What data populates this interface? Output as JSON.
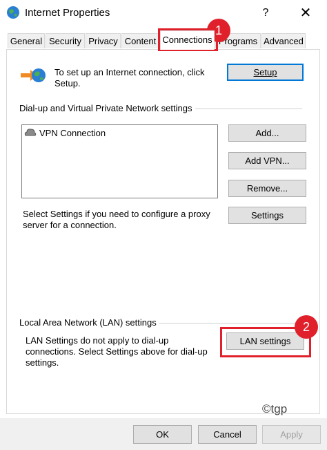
{
  "window": {
    "title": "Internet Properties",
    "help_glyph": "?",
    "close_glyph": "✕"
  },
  "tabs": [
    {
      "label": "General"
    },
    {
      "label": "Security"
    },
    {
      "label": "Privacy"
    },
    {
      "label": "Content"
    },
    {
      "label": "Connections"
    },
    {
      "label": "Programs"
    },
    {
      "label": "Advanced"
    }
  ],
  "setup": {
    "text": "To set up an Internet connection, click Setup.",
    "button": "Setup"
  },
  "dialup": {
    "group_label": "Dial-up and Virtual Private Network settings",
    "list_items": [
      {
        "label": "VPN Connection"
      }
    ],
    "add_button": "Add...",
    "add_vpn_button": "Add VPN...",
    "remove_button": "Remove...",
    "proxy_text": "Select Settings if you need to configure a proxy server for a connection.",
    "settings_button": "Settings"
  },
  "lan": {
    "group_label": "Local Area Network (LAN) settings",
    "text": "LAN Settings do not apply to dial-up connections. Select Settings above for dial-up settings.",
    "button": "LAN settings"
  },
  "annotations": {
    "badge_1": "1",
    "badge_2": "2",
    "highlight_color": "#e0202a"
  },
  "watermark": "©tgp",
  "footer": {
    "ok": "OK",
    "cancel": "Cancel",
    "apply": "Apply"
  },
  "colors": {
    "accent": "#0078d7",
    "button_bg": "#e1e1e1",
    "dialog_bg": "#f0f0f0"
  }
}
